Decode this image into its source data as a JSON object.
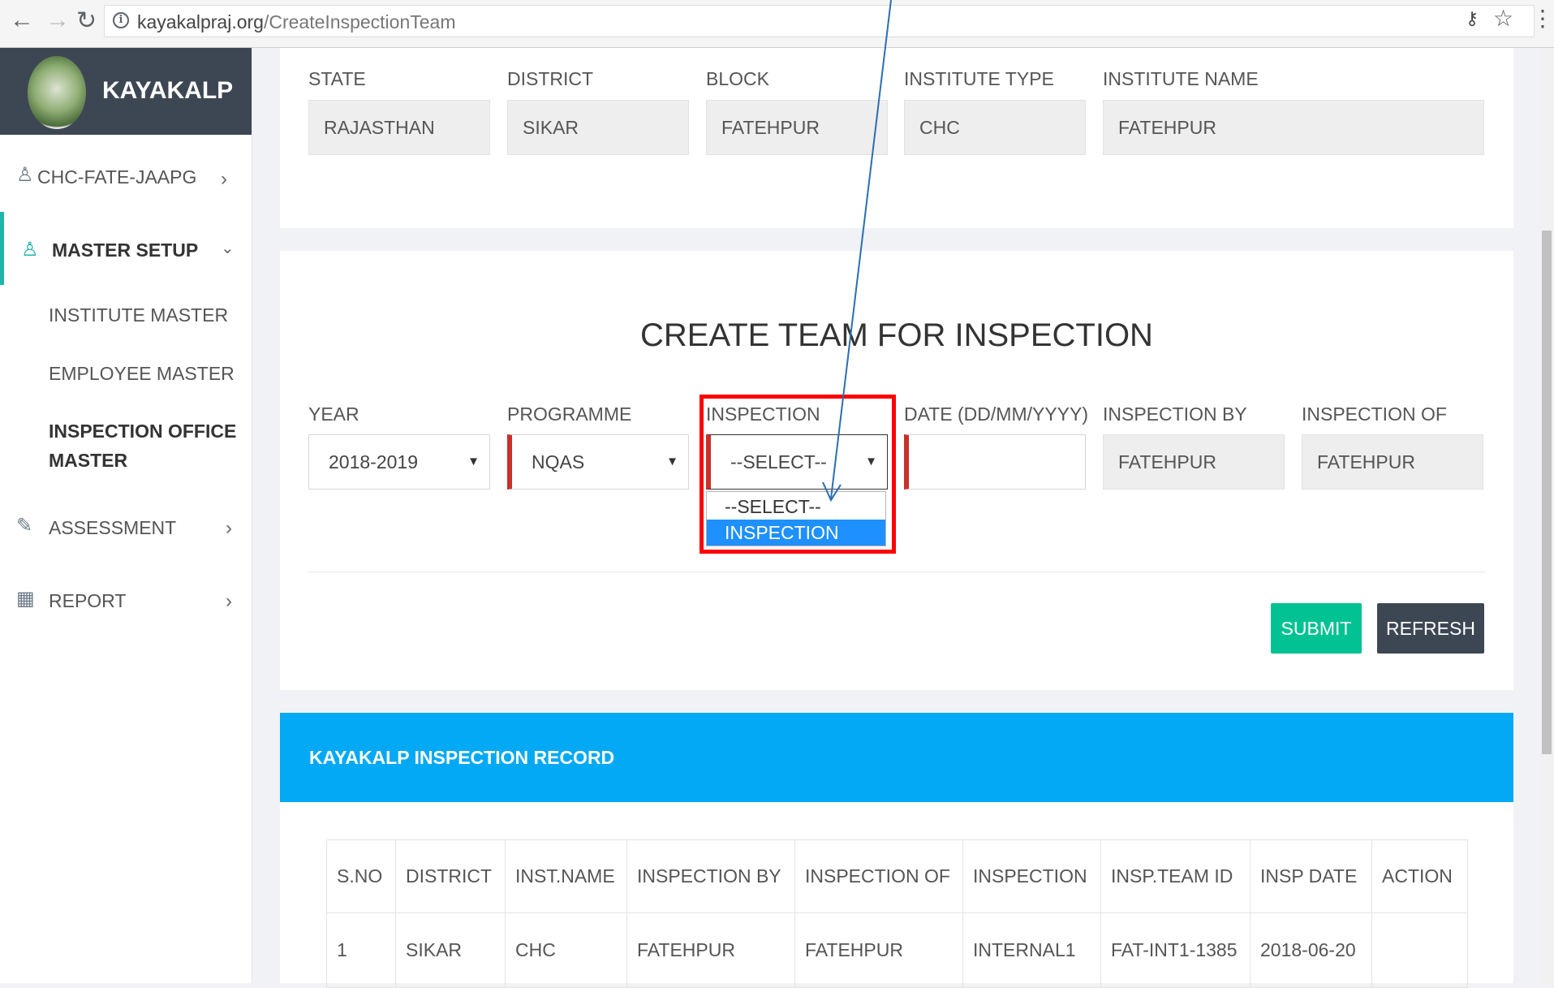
{
  "browser": {
    "url_domain": "kayakalpraj.org",
    "url_path": "/CreateInspectionTeam"
  },
  "sidebar": {
    "brand": "KAYAKALP",
    "user": "CHC-FATE-JAAPG",
    "master_setup": "MASTER SETUP",
    "sub_items": [
      "INSTITUTE MASTER",
      "EMPLOYEE MASTER",
      "INSPECTION OFFICE",
      "MASTER"
    ],
    "assessment": "ASSESSMENT",
    "report": "REPORT"
  },
  "institute": {
    "labels": [
      "STATE",
      "DISTRICT",
      "BLOCK",
      "INSTITUTE TYPE",
      "INSTITUTE NAME"
    ],
    "values": [
      "RAJASTHAN",
      "SIKAR",
      "FATEHPUR",
      "CHC",
      "FATEHPUR"
    ]
  },
  "form": {
    "title": "CREATE TEAM FOR INSPECTION",
    "labels": [
      "YEAR",
      "PROGRAMME",
      "INSPECTION",
      "DATE (DD/MM/YYYY)",
      "INSPECTION BY",
      "INSPECTION OF"
    ],
    "year": "2018-2019",
    "programme": "NQAS",
    "inspection": "--SELECT--",
    "date": "",
    "inspection_by": "FATEHPUR",
    "inspection_of": "FATEHPUR",
    "inspection_options": [
      "--SELECT--",
      "INSPECTION"
    ],
    "submit": "SUBMIT",
    "refresh": "REFRESH"
  },
  "records": {
    "heading": "KAYAKALP INSPECTION RECORD",
    "columns": [
      "S.NO",
      "DISTRICT",
      "INST.NAME",
      "INSPECTION BY",
      "INSPECTION OF",
      "INSPECTION",
      "INSP.TEAM ID",
      "INSP DATE",
      "ACTION"
    ],
    "rows": [
      [
        "1",
        "SIKAR",
        "CHC",
        "FATEHPUR",
        "FATEHPUR",
        "INTERNAL1",
        "FAT-INT1-1385",
        "2018-06-20",
        ""
      ]
    ]
  },
  "colors": {
    "sidebar_header": "#3d4754",
    "accent_teal": "#1fb5ac",
    "record_header": "#03a9f4",
    "submit": "#00c292",
    "refresh": "#3d4754",
    "required": "#c9302c",
    "highlight_frame": "#ff0000",
    "option_highlight": "#1e90ff",
    "annotation_arrow": "#2a6fb0"
  }
}
